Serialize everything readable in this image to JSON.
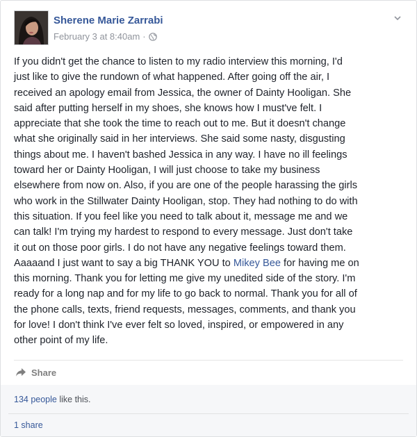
{
  "post": {
    "author": "Sherene Marie Zarrabi",
    "timestamp": "February 3 at 8:40am",
    "separator": "·",
    "privacy_icon": "globe-icon",
    "menu_icon": "chevron-down-icon",
    "text_lines": [
      "If you didn't get the chance to listen to my radio interview this morning, I'd",
      "just like to give the rundown of what happened. After going off the air, I",
      "received an apology email from Jessica, the owner of Dainty Hooligan. She",
      "said after putting herself in my shoes, she knows how I must've felt. I",
      "appreciate that she took the time to reach out to me. But it doesn't change",
      "what she originally said in her interviews. She said some nasty, disgusting",
      "things about me. I haven't bashed Jessica in any way. I have no ill feelings",
      "toward her or Dainty Hooligan, I will just choose to take my business",
      "elsewhere from now on. Also, if you are one of the people harassing the girls",
      "who work in the Stillwater Dainty Hooligan, stop. They had nothing to do with",
      "this situation. If you feel like you need to talk about it, message me and we",
      "can talk! I'm trying my hardest to respond to every message. Just don't take",
      "it out on those poor girls. I do not have any negative feelings toward them."
    ],
    "mention_line": {
      "before": "Aaaaand I just want to say a big THANK YOU to ",
      "mention": "Mikey Bee",
      "after": " for having me on"
    },
    "text_lines_after": [
      "this morning. Thank you for letting me give my unedited side of the story. I'm",
      "ready for a long nap and for my life to go back to normal. Thank you for all of",
      "the phone calls, texts, friend requests, messages, comments, and thank you",
      "for love! I don't think I've ever felt so loved, inspired, or empowered in any",
      "other point of my life."
    ]
  },
  "actions": {
    "share_label": "Share",
    "share_icon": "share-arrow-icon"
  },
  "engagement": {
    "likes_count": "134 people",
    "likes_suffix": " like this.",
    "shares": "1 share"
  },
  "colors": {
    "link": "#365899",
    "text": "#1d2129",
    "meta": "#90949c",
    "footer_bg": "#f6f7f9"
  }
}
